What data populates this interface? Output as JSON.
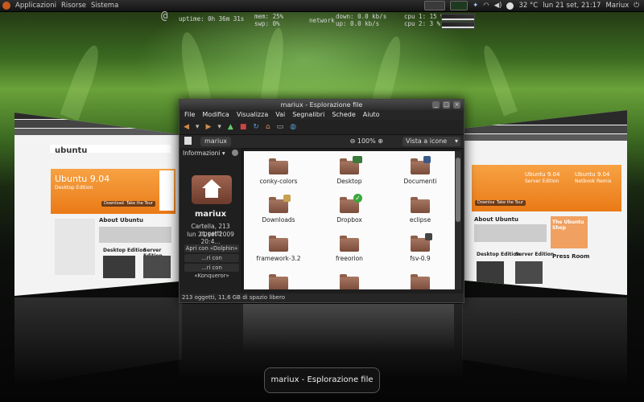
{
  "panel": {
    "menu_apps": "Applicazioni",
    "menu_places": "Risorse",
    "menu_system": "Sistema",
    "temp": "32 °C",
    "clock": "lun 21 set, 21:17",
    "user": "Mariux"
  },
  "conky": {
    "uptime": "uptime: 0h 36m 31s",
    "mem": "mem: 25%",
    "swp": "swp: 0%",
    "network_label": "network",
    "down": "down: 0.0 kb/s",
    "up": "up: 0.0 kb/s",
    "cpu1": "cpu 1: 15 %",
    "cpu2": "cpu 2: 3 %"
  },
  "left_window": {
    "brand": "ubuntu",
    "hero_title": "Ubuntu 9.04",
    "hero_sub": "Desktop Edition",
    "btn_download": "Download",
    "btn_tour": "Take the Tour",
    "about": "About Ubuntu",
    "desktop": "Desktop Edition",
    "server": "Server Edition"
  },
  "right_window": {
    "hero_title": "Ubuntu 9.04",
    "hero_sub": "Server Edition",
    "hero2_title": "Ubuntu 9.04",
    "hero2_sub": "Netbook Remix",
    "btn_download": "Download",
    "btn_tour": "Take the Tour",
    "about": "About Ubuntu",
    "desktop": "Desktop Edition",
    "server": "Server Edition",
    "shop": "The Ubuntu Shop",
    "press": "Press Room"
  },
  "window": {
    "title": "mariux - Esplorazione file",
    "menus": [
      "File",
      "Modifica",
      "Visualizza",
      "Vai",
      "Segnalibri",
      "Schede",
      "Aiuto"
    ],
    "location": "mariux",
    "zoom": "100%",
    "view_mode": "Vista a icone",
    "sidebar": {
      "header": "Informazioni",
      "name": "mariux",
      "info_line1": "Cartella, 213 oggetti",
      "info_line2": "lun 21 set 2009 20:4...",
      "open_dolphin": "Apri con «Dolphin»",
      "open_gwenview": "...ri con «Gwenview»",
      "open_konqueror": "...ri con «Konqueror»"
    },
    "items": [
      {
        "label": "conky-colors"
      },
      {
        "label": "Desktop"
      },
      {
        "label": "Documenti"
      },
      {
        "label": "Downloads"
      },
      {
        "label": "Dropbox"
      },
      {
        "label": "eclipse"
      },
      {
        "label": "framework-3.2"
      },
      {
        "label": "freeorion"
      },
      {
        "label": "fsv-0.9"
      }
    ],
    "status": "213 oggetti, 11,6 GB di spazio libero"
  },
  "tooltip": "mariux - Esplorazione file",
  "colors": {
    "ubuntu_orange": "#ea7a16",
    "folder_brown": "#8f5f4a"
  }
}
